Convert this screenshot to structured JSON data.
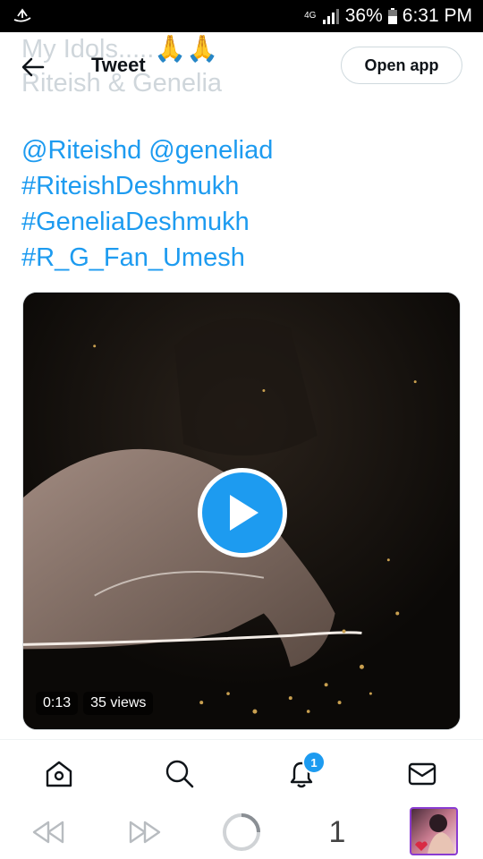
{
  "status_bar": {
    "network": "4G",
    "battery_percent": "36%",
    "time": "6:31 PM",
    "left_icon": "upload-notification-icon"
  },
  "header": {
    "faded_line1": "My Idols.....🙏🙏",
    "faded_line2": "Riteish & Genelia",
    "title": "Tweet",
    "open_app_label": "Open app",
    "back_icon": "arrow-left-icon"
  },
  "tweet": {
    "lines": [
      "@Riteishd @geneliad",
      "#RiteishDeshmukh",
      "#GeneliaDeshmukh",
      "#R_G_Fan_Umesh"
    ],
    "link_color": "#1d9bf0"
  },
  "video": {
    "duration": "0:13",
    "views": "35 views",
    "play_icon": "play-icon"
  },
  "tabbar": {
    "items": [
      "home-icon",
      "search-icon",
      "notifications-icon",
      "messages-icon"
    ],
    "notification_count": "1"
  },
  "browser_nav": {
    "back": "rewind-icon",
    "forward": "fast-forward-icon",
    "reload": "loading-spinner-icon",
    "tab_count": "1"
  }
}
